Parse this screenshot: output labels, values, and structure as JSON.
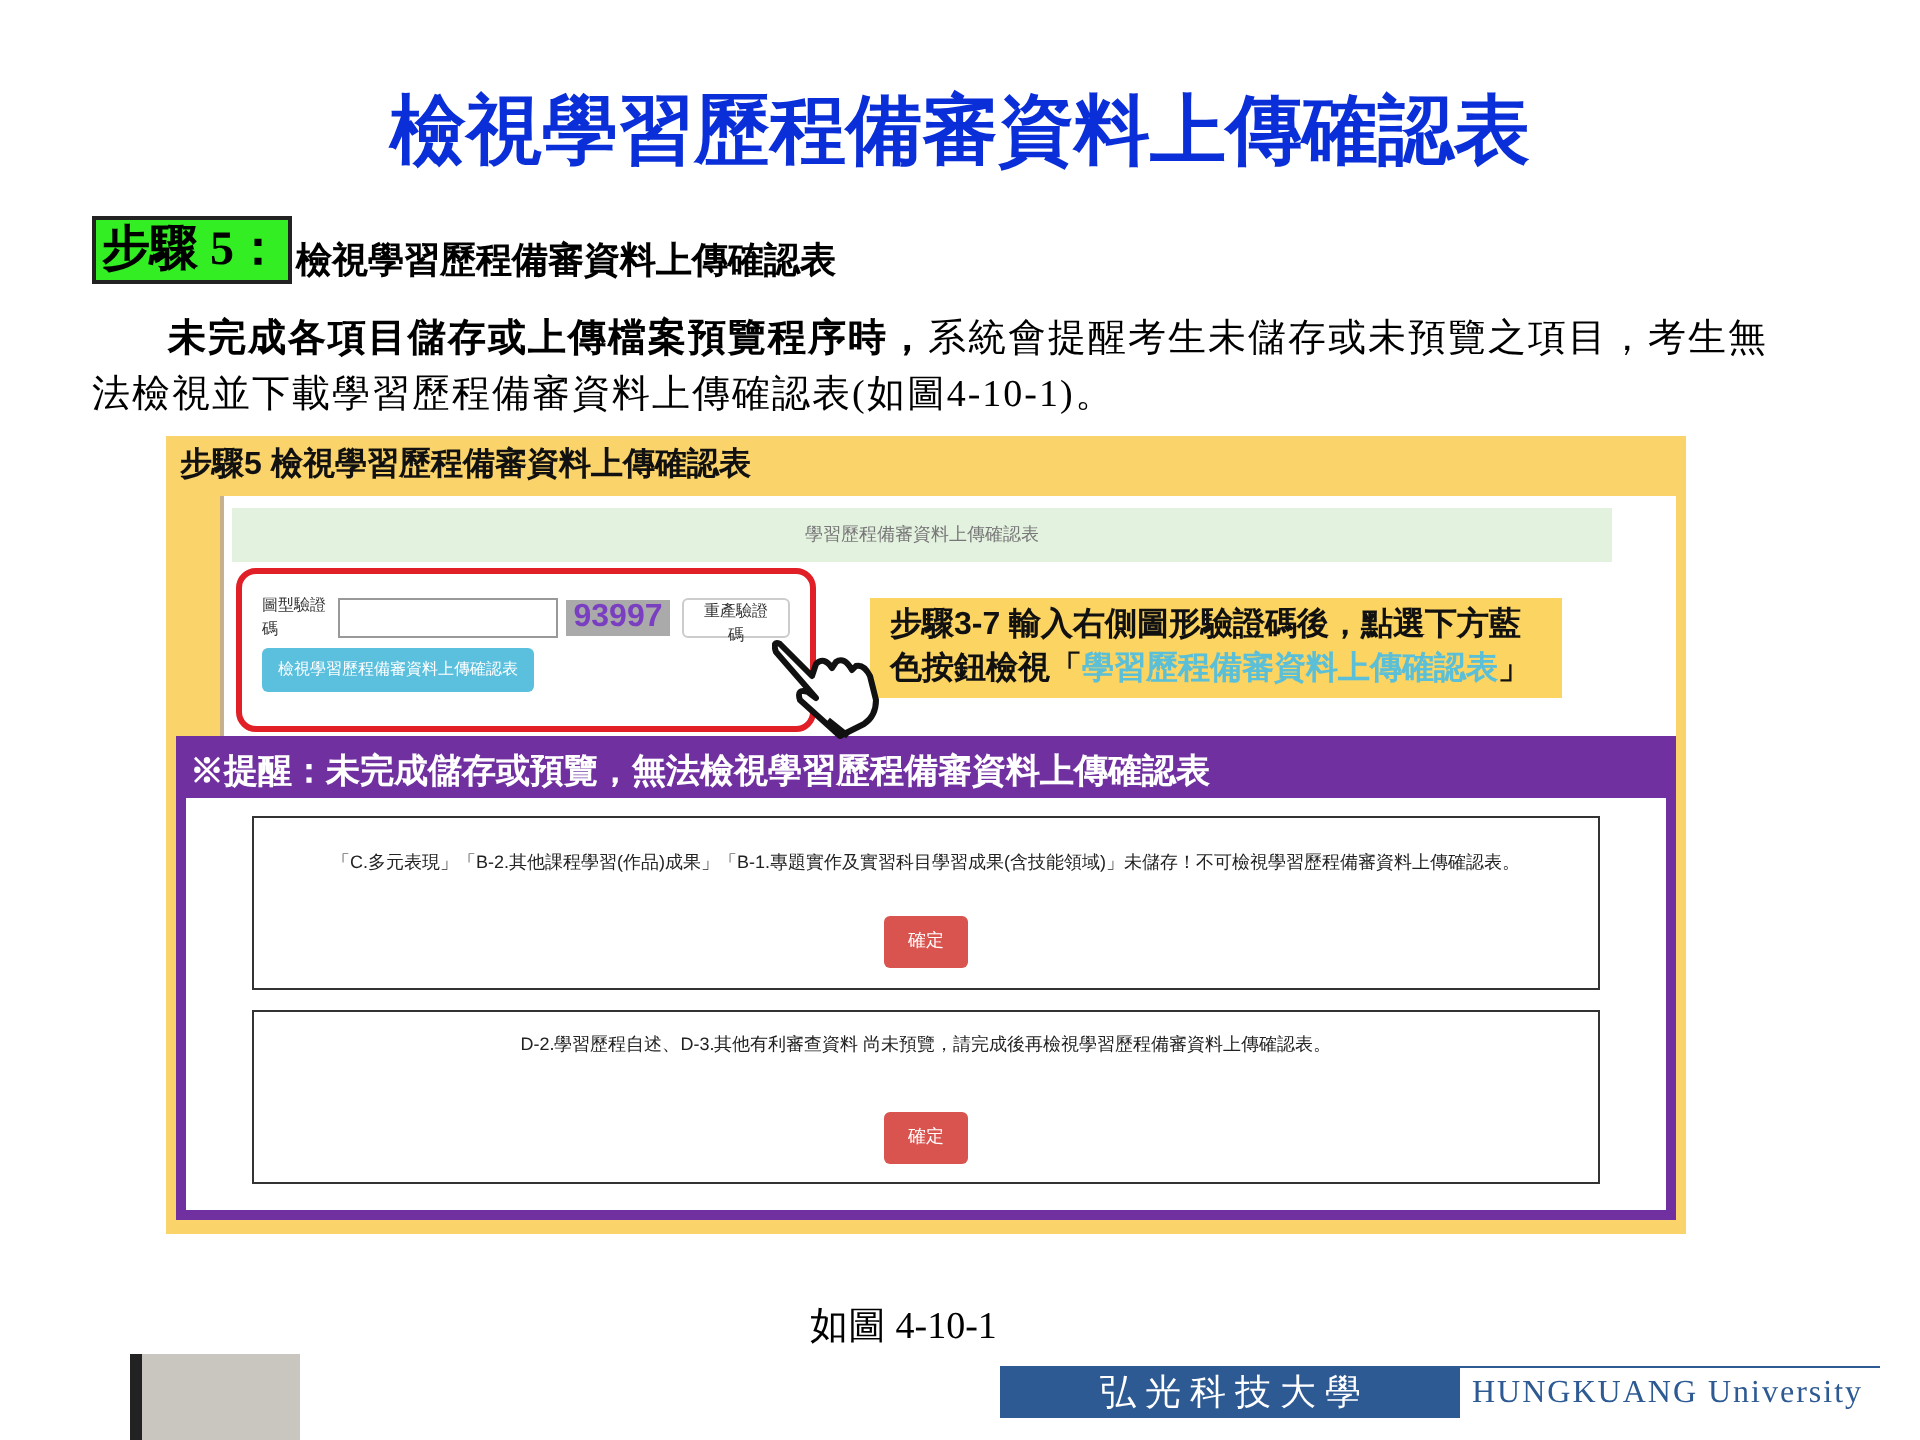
{
  "title": "檢視學習歷程備審資料上傳確認表",
  "step": {
    "label": "步驟 5：",
    "heading": "檢視學習歷程備審資料上傳確認表"
  },
  "paragraph": "**未完成各項目儲存或上傳檔案預覽程序時，**系統會提醒考生未儲存或未預覽之項目，考生無法檢視並下載學習歷程備審資料上傳確認表(如圖4-10-1)。",
  "screenshot": {
    "header": "步驟5 檢視學習歷程備審資料上傳確認表",
    "panel_title": "學習歷程備審資料上傳確認表",
    "captcha_label": "圖型驗證碼",
    "captcha_code": "93997",
    "refresh_button": "重產驗證碼",
    "view_button": "檢視學習歷程備審資料上傳確認表",
    "callout": {
      "text": "步驟3-7 輸入右側圖形驗證碼後，點選下方藍色按鈕檢視「",
      "highlight": "學習歷程備審資料上傳確認表",
      "text_after": "」"
    },
    "alert_header": "※提醒：未完成儲存或預覽，無法檢視學習歷程備審資料上傳確認表",
    "dialogs": [
      {
        "message": "「C.多元表現」「B-2.其他課程學習(作品)成果」「B-1.專題實作及實習科目學習成果(含技能領域)」未儲存！不可檢視學習歷程備審資料上傳確認表。",
        "button": "確定"
      },
      {
        "message": "D-2.學習歷程自述、D-3.其他有利審查資料 尚未預覽，請完成後再檢視學習歷程備審資料上傳確認表。",
        "button": "確定"
      }
    ]
  },
  "caption": "如圖 4-10-1",
  "footer": {
    "name_zh": "弘 光 科 技 大 學",
    "name_en": "HUNGKUANG University"
  }
}
